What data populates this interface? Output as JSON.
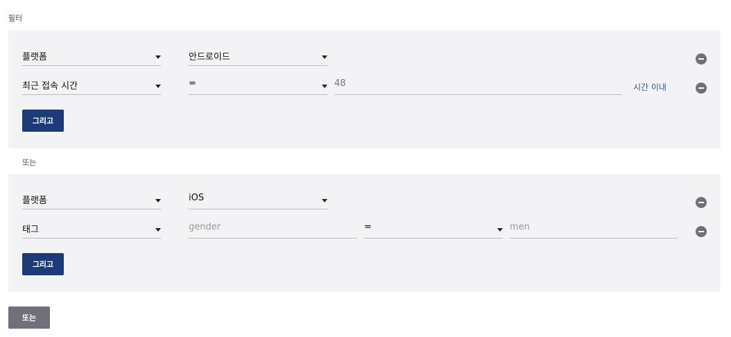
{
  "filter_label": "필터",
  "or_divider_label": "또는",
  "group1": {
    "row1": {
      "field": "플랫폼",
      "value": "안드로이드"
    },
    "row2": {
      "field": "최근 접속 시간",
      "operator": "=",
      "value": "48",
      "suffix": "시간 이내"
    },
    "and_button": "그리고"
  },
  "group2": {
    "row1": {
      "field": "플랫폼",
      "value": "iOS"
    },
    "row2": {
      "field": "태그",
      "key_placeholder": "gender",
      "operator": "=",
      "value_placeholder": "men"
    },
    "and_button": "그리고"
  },
  "or_button": "또는",
  "colors": {
    "primary": "#1c3b78",
    "secondary": "#6f7079",
    "link": "#2d5ea8",
    "panel": "#f3f3f5"
  }
}
